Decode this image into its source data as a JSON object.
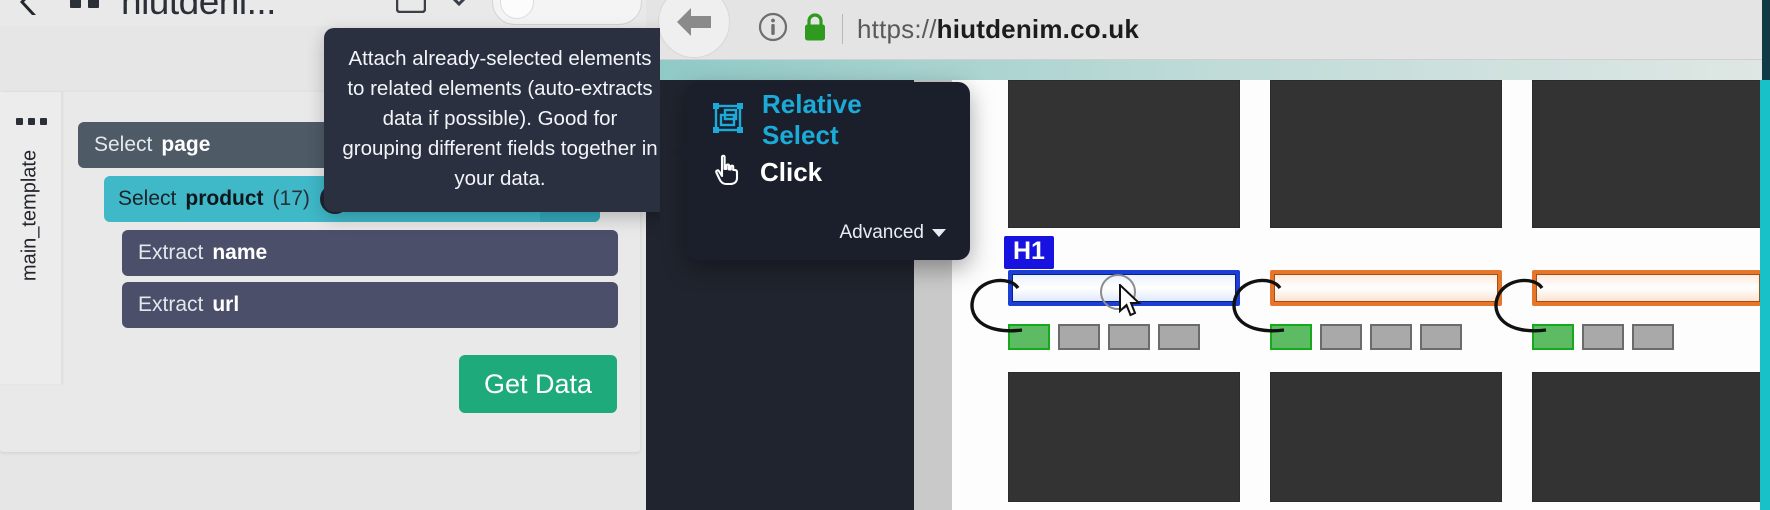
{
  "app": {
    "header": {
      "back_icon": "back-arrow-icon",
      "menu_icon": "grid-dots-icon",
      "title": "hiutdeni...",
      "browser_icon": "browser-window-icon",
      "caret_icon": "chevron-down-icon"
    },
    "template": {
      "rail_label": "main_template",
      "rail_menu_icon": "ellipsis-icon",
      "rows": [
        {
          "type": "select",
          "verb": "Select",
          "name": "page",
          "count": "",
          "list_icon": ""
        },
        {
          "type": "select",
          "verb": "Select",
          "name": "product",
          "count": "(17)",
          "list_icon": "list-icon",
          "trash_icon": "trash-icon",
          "plus_icon": "plus-icon"
        },
        {
          "type": "extract",
          "verb": "Extract",
          "name": "name"
        },
        {
          "type": "extract",
          "verb": "Extract",
          "name": "url"
        }
      ],
      "get_data_label": "Get Data"
    },
    "tooltip": {
      "text": "Attach already-selected elements to related elements (auto-extracts data if possible). Good for grouping different fields together in your data."
    },
    "action_menu": {
      "items": [
        {
          "label": "Relative Select",
          "icon": "relative-select-icon",
          "accent": true
        },
        {
          "label": "Click",
          "icon": "pointer-hand-icon",
          "accent": false
        }
      ],
      "advanced_label": "Advanced",
      "advanced_caret_icon": "chevron-down-icon"
    }
  },
  "browser": {
    "back_icon": "back-arrow-icon",
    "info_icon": "info-circle-icon",
    "lock_icon": "padlock-icon",
    "url_prefix": "https://",
    "url_domain": "hiutdenim.co.uk",
    "url_full": "https://hiutdenim.co.uk"
  },
  "page_preview": {
    "highlight_badge": "H1",
    "cursor_icon": "mouse-cursor-icon",
    "columns": [
      {
        "selection": "blue",
        "swatches": [
          "green",
          "grey",
          "grey",
          "grey"
        ]
      },
      {
        "selection": "orange",
        "swatches": [
          "green",
          "grey",
          "grey",
          "grey"
        ]
      },
      {
        "selection": "orange",
        "swatches": [
          "green",
          "grey",
          "grey"
        ]
      }
    ]
  },
  "colors": {
    "teal_row": "#3fb8c8",
    "slate_row": "#4e5a66",
    "extract_row": "#4b4f69",
    "get_data": "#1faa7c",
    "accent_cyan": "#1cabd8",
    "badge_blue": "#1712e0",
    "select_orange": "#e8762a",
    "lock_green": "#2e9b1e",
    "tooltip_bg": "#2b3040",
    "menu_bg": "#1b1f2b"
  }
}
